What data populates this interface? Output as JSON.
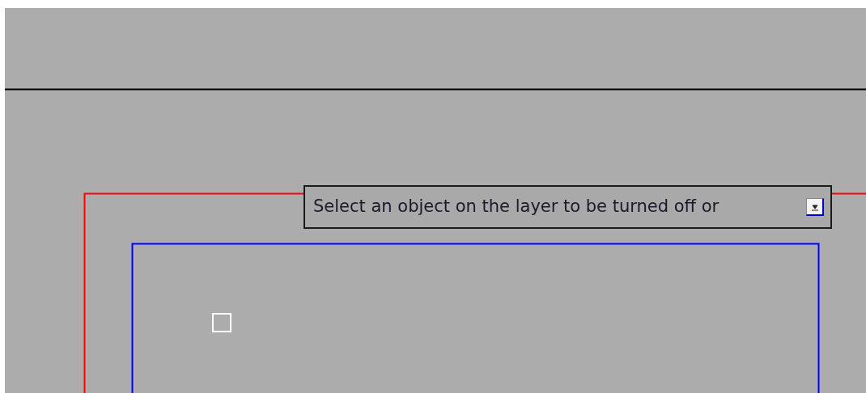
{
  "dynamic_input": {
    "prompt": "Select an object on the layer to be turned off or"
  }
}
